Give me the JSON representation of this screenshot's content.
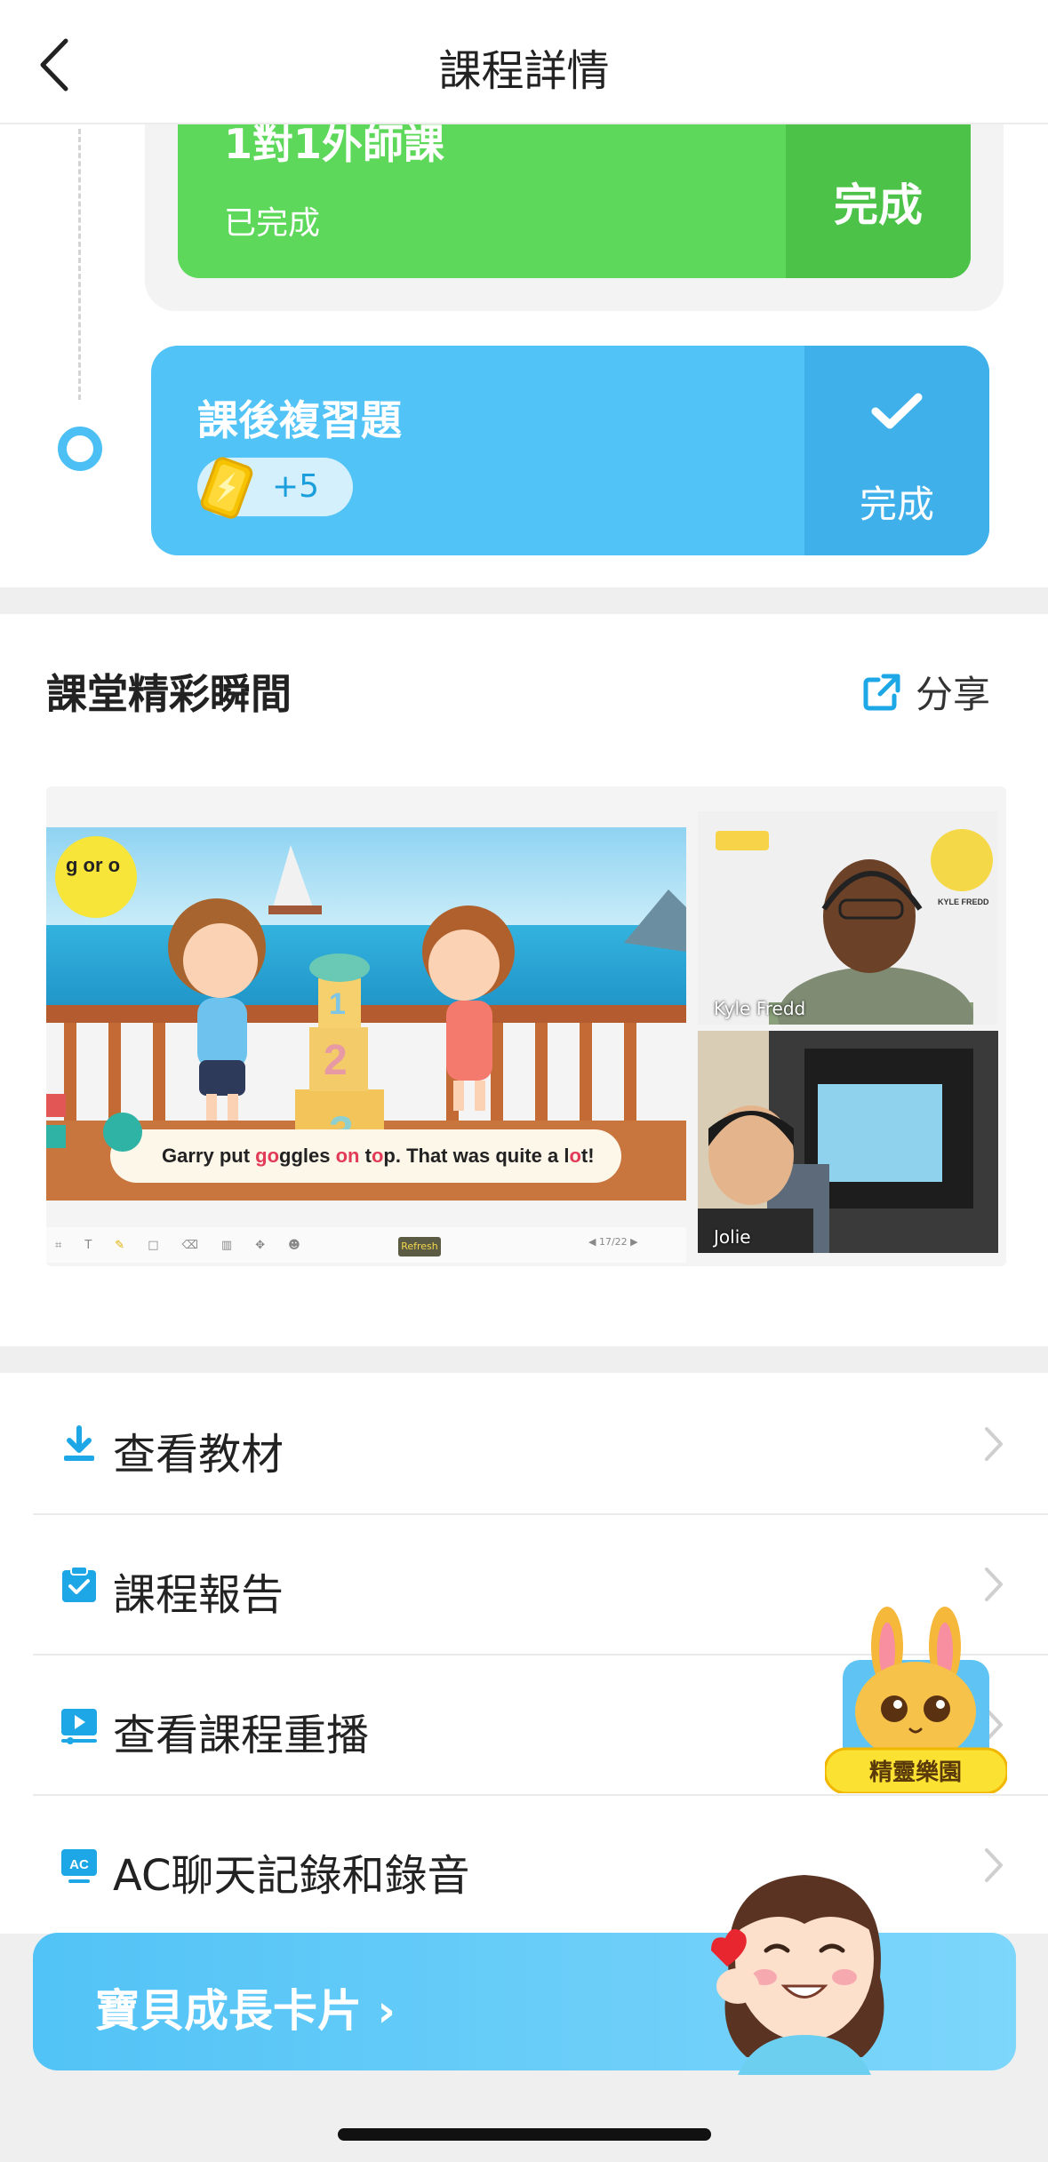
{
  "header": {
    "title": "課程詳情"
  },
  "timeline": {
    "one_on_one": {
      "title": "1對1外師課",
      "status": "已完成",
      "done_label": "完成"
    },
    "review": {
      "title": "課後複習題",
      "coins": "+5",
      "done_label": "完成"
    }
  },
  "highlights": {
    "title": "課堂精彩瞬間",
    "share_label": "分享",
    "slide": {
      "phonics": "g or o",
      "sentence_pre": "Garry put ",
      "sentence_hl1": "go",
      "sentence_mid1": "ggles ",
      "sentence_hl2": "on",
      "sentence_mid2": " t",
      "sentence_hl3": "o",
      "sentence_mid3": "p. That was quite a l",
      "sentence_hl4": "o",
      "sentence_end": "t!",
      "refresh": "Refresh",
      "page": "17/22"
    },
    "teacher_name": "Kyle Fredd",
    "teacher_banner": "TEACHER\nKYLE FREDD",
    "student_name": "Jolie"
  },
  "menu": [
    {
      "label": "查看教材",
      "icon": "download-icon"
    },
    {
      "label": "課程報告",
      "icon": "clipboard-check-icon"
    },
    {
      "label": "查看課程重播",
      "icon": "video-replay-icon"
    },
    {
      "label": "AC聊天記錄和錄音",
      "icon": "ac-chat-icon"
    }
  ],
  "mascot": {
    "label": "精靈樂園"
  },
  "growth_card": {
    "label": "寶貝成長卡片"
  },
  "colors": {
    "green": "#5dd85a",
    "blue": "#52c3f6",
    "accent": "#1ea7e6"
  }
}
